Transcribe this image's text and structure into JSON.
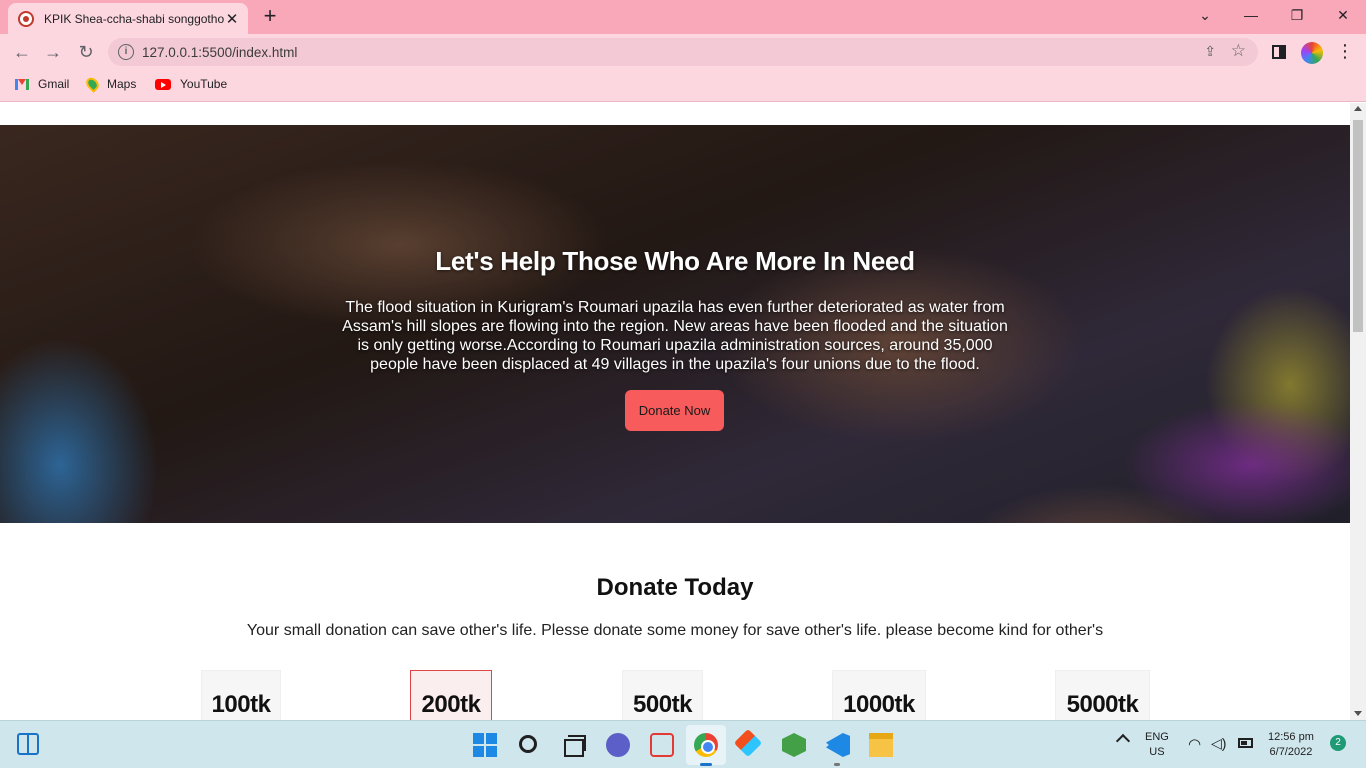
{
  "browser": {
    "tab": {
      "title": "KPIK Shea-ccha-shabi songgothon",
      "close": "✕"
    },
    "new_tab": "+",
    "window_controls": {
      "minimize": "—",
      "maximize": "❐",
      "close": "✕",
      "dropdown": "⌄"
    },
    "nav": {
      "back": "←",
      "forward": "→",
      "reload": "↻"
    },
    "address_bar": {
      "url": "127.0.0.1:5500/index.html",
      "info_icon": "i"
    },
    "bookmarks": [
      {
        "label": "Gmail",
        "icon": "gmail-icon"
      },
      {
        "label": "Maps",
        "icon": "maps-icon"
      },
      {
        "label": "YouTube",
        "icon": "youtube-icon"
      }
    ],
    "menu": "⋮"
  },
  "hero": {
    "title": "Let's Help Those Who Are More In Need",
    "text": "The flood situation in Kurigram's Roumari upazila has even further deteriorated as water from Assam's hill slopes are flowing into the region. New areas have been flooded and the situation is only getting worse.According to Roumari upazila administration sources, around 35,000 people have been displaced at 49 villages in the upazila's four unions due to the flood.",
    "button_label": "Donate Now",
    "button_color": "#f75b5b"
  },
  "donate": {
    "title": "Donate Today",
    "subtitle": "Your small donation can save other's life. Plesse donate some money for save other's life. please become kind for other's",
    "amounts": [
      {
        "label": "100tk",
        "selected": false
      },
      {
        "label": "200tk",
        "selected": true
      },
      {
        "label": "500tk",
        "selected": false
      },
      {
        "label": "1000tk",
        "selected": false
      },
      {
        "label": "5000tk",
        "selected": false
      }
    ],
    "selected_border_color": "#e04545"
  },
  "taskbar": {
    "language": {
      "line1": "ENG",
      "line2": "US"
    },
    "clock": {
      "time": "12:56 pm",
      "date": "6/7/2022"
    },
    "notification_count": "2"
  }
}
